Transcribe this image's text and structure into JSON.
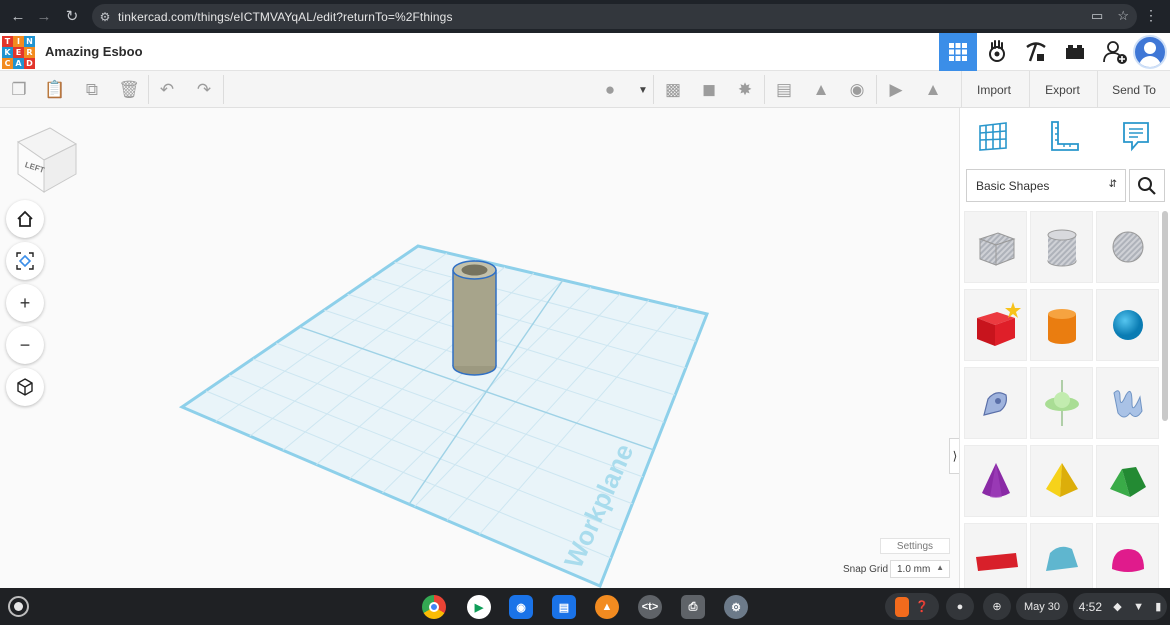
{
  "browser": {
    "url": "tinkercad.com/things/eICTMVAYqAL/edit?returnTo=%2Fthings"
  },
  "header": {
    "logo_letters": [
      "T",
      "I",
      "N",
      "K",
      "E",
      "R",
      "C",
      "A",
      "D"
    ],
    "title": "Amazing Esboo"
  },
  "toolbar": {
    "import_label": "Import",
    "export_label": "Export",
    "send_to_label": "Send To"
  },
  "viewport": {
    "viewcube_label": "LEFT",
    "workplane_label": "Workplane",
    "settings_label": "Settings",
    "snap_grid_label": "Snap Grid",
    "snap_grid_value": "1.0 mm"
  },
  "panel": {
    "category_value": "Basic Shapes",
    "shapes": [
      {
        "name": "box-hole",
        "color": "#b9bcc4"
      },
      {
        "name": "cylinder-hole",
        "color": "#c4c6cc"
      },
      {
        "name": "sphere-hole",
        "color": "#b7bac0"
      },
      {
        "name": "box",
        "color": "#d9202a"
      },
      {
        "name": "cylinder",
        "color": "#f08a1c"
      },
      {
        "name": "sphere",
        "color": "#169ad4"
      },
      {
        "name": "scribble",
        "color": "#8ea5d6"
      },
      {
        "name": "graphic",
        "color": "#a8d898"
      },
      {
        "name": "sketch-text",
        "color": "#9cb8dc"
      },
      {
        "name": "cone",
        "color": "#8b2fa8"
      },
      {
        "name": "pyramid",
        "color": "#f4cf12"
      },
      {
        "name": "roof",
        "color": "#2e9e3e"
      },
      {
        "name": "text",
        "color": "#d9202a"
      },
      {
        "name": "round-roof",
        "color": "#5fb6cf"
      },
      {
        "name": "half-sphere",
        "color": "#e01b8c"
      }
    ]
  },
  "shelf": {
    "date": "May 30",
    "time": "4:52"
  },
  "colors": {
    "accent": "#3b8ee8",
    "workplane": "#8ed0ea",
    "tube": "#a7a48b"
  }
}
